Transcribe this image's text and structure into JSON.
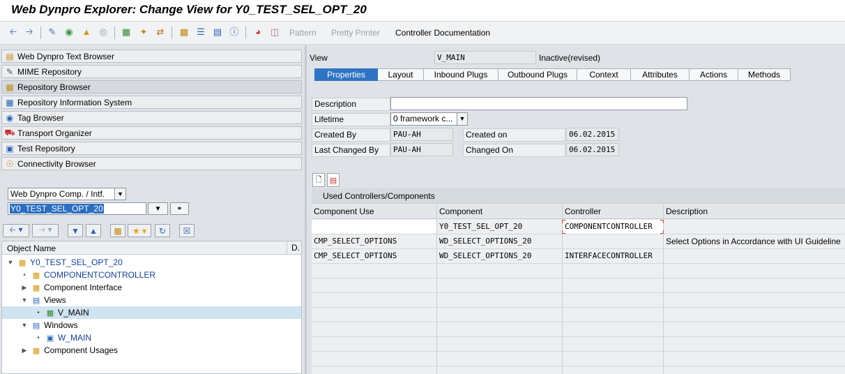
{
  "window": {
    "title": "Web Dynpro Explorer: Change View for Y0_TEST_SEL_OPT_20"
  },
  "toolbar": {
    "pattern": "Pattern",
    "pretty_printer": "Pretty Printer",
    "controller_doc": "Controller Documentation"
  },
  "nav": [
    {
      "label": "Web Dynpro Text Browser",
      "icon": "text-browser-icon"
    },
    {
      "label": "MIME Repository",
      "icon": "mime-icon"
    },
    {
      "label": "Repository Browser",
      "icon": "repository-icon"
    },
    {
      "label": "Repository Information System",
      "icon": "info-system-icon"
    },
    {
      "label": "Tag Browser",
      "icon": "tag-icon"
    },
    {
      "label": "Transport Organizer",
      "icon": "transport-icon"
    },
    {
      "label": "Test Repository",
      "icon": "test-icon"
    },
    {
      "label": "Connectivity Browser",
      "icon": "connectivity-icon"
    }
  ],
  "object_type": {
    "value": "Web Dynpro Comp. / Intf."
  },
  "object_name": {
    "value": "Y0_TEST_SEL_OPT_20"
  },
  "tree": {
    "col_name": "Object Name",
    "col_d": "D.",
    "nodes": [
      {
        "label": "Y0_TEST_SEL_OPT_20"
      },
      {
        "label": "COMPONENTCONTROLLER"
      },
      {
        "label": "Component Interface"
      },
      {
        "label": "Views"
      },
      {
        "label": "V_MAIN"
      },
      {
        "label": "Windows"
      },
      {
        "label": "W_MAIN"
      },
      {
        "label": "Component Usages"
      }
    ]
  },
  "view": {
    "label": "View",
    "name": "V_MAIN",
    "status": "Inactive(revised)"
  },
  "tabs": [
    "Properties",
    "Layout",
    "Inbound Plugs",
    "Outbound Plugs",
    "Context",
    "Attributes",
    "Actions",
    "Methods"
  ],
  "properties": {
    "description_label": "Description",
    "lifetime_label": "Lifetime",
    "lifetime_value": "0 framework c...",
    "created_by_label": "Created By",
    "created_by_value": "PAU-AH",
    "created_on_label": "Created on",
    "created_on_value": "06.02.2015",
    "last_changed_by_label": "Last Changed By",
    "last_changed_by_value": "PAU-AH",
    "changed_on_label": "Changed On",
    "changed_on_value": "06.02.2015"
  },
  "grid": {
    "title": "Used Controllers/Components",
    "headers": [
      "Component Use",
      "Component",
      "Controller",
      "Description"
    ],
    "rows": [
      [
        "",
        "Y0_TEST_SEL_OPT_20",
        "COMPONENTCONTROLLER",
        ""
      ],
      [
        "CMP_SELECT_OPTIONS",
        "WD_SELECT_OPTIONS_20",
        "",
        "Select Options in Accordance with UI Guideline"
      ],
      [
        "CMP_SELECT_OPTIONS",
        "WD_SELECT_OPTIONS_20",
        "INTERFACECONTROLLER",
        ""
      ]
    ]
  }
}
